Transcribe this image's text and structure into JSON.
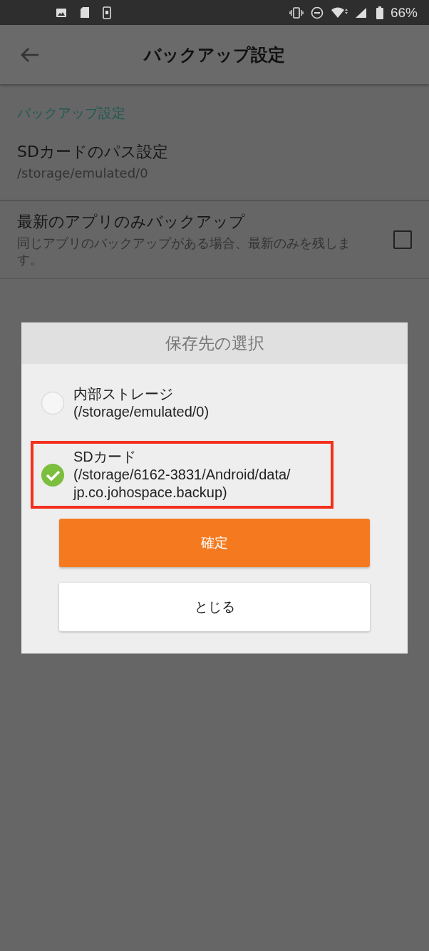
{
  "status_bar": {
    "battery": "66%"
  },
  "app_bar": {
    "title": "バックアップ設定"
  },
  "settings": {
    "section": "バックアップ設定",
    "items": [
      {
        "kind": "plain",
        "title": "SDカードのパス設定",
        "summary": "/storage/emulated/0"
      },
      {
        "kind": "checkbox",
        "title": "最新のアプリのみバックアップ",
        "summary": "同じアプリのバックアップがある場合、最新のみを残します。",
        "checked": false
      }
    ]
  },
  "dialog": {
    "title": "保存先の選択",
    "options": [
      {
        "label": "内部ストレージ",
        "path": "(/storage/emulated/0)",
        "selected": false,
        "highlighted": false
      },
      {
        "label": "SDカード",
        "path": "(/storage/6162-3831/Android/data/jp.co.johospace.backup)",
        "selected": true,
        "highlighted": true
      }
    ],
    "buttons": [
      {
        "kind": "primary",
        "label": "確定"
      },
      {
        "kind": "secondary",
        "label": "とじる"
      }
    ]
  }
}
